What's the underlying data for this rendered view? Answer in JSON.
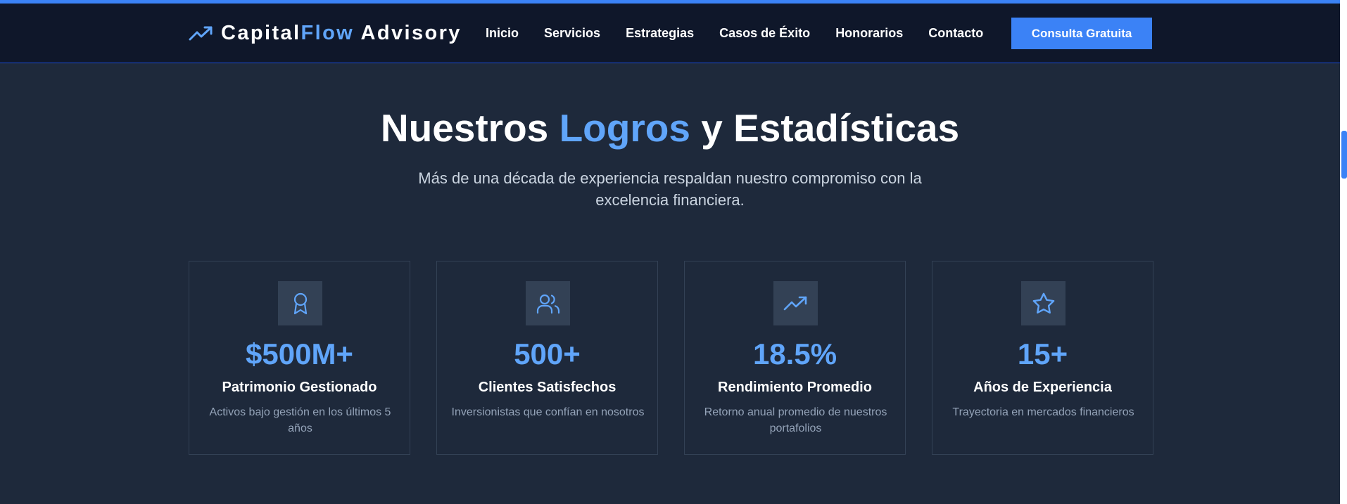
{
  "brand": {
    "name_part1": "Capital",
    "name_part2": "Flow",
    "name_part3": " Advisory",
    "icon": "trending-up-icon"
  },
  "nav": {
    "items": [
      "Inicio",
      "Servicios",
      "Estrategias",
      "Casos de Éxito",
      "Honorarios",
      "Contacto"
    ],
    "cta_label": "Consulta Gratuita"
  },
  "section": {
    "title_part1": "Nuestros ",
    "title_accent": "Logros",
    "title_part2": " y Estadísticas",
    "subtitle": "Más de una década de experiencia respaldan nuestro compromiso con la excelencia financiera."
  },
  "stats": [
    {
      "icon": "award-icon",
      "value": "$500M+",
      "title": "Patrimonio Gestionado",
      "description": "Activos bajo gestión en los últimos 5 años"
    },
    {
      "icon": "users-icon",
      "value": "500+",
      "title": "Clientes Satisfechos",
      "description": "Inversionistas que confían en nosotros"
    },
    {
      "icon": "trending-up-icon",
      "value": "18.5%",
      "title": "Rendimiento Promedio",
      "description": "Retorno anual promedio de nuestros portafolios"
    },
    {
      "icon": "star-icon",
      "value": "15+",
      "title": "Años de Experiencia",
      "description": "Trayectoria en mercados financieros"
    }
  ],
  "colors": {
    "accent": "#3b82f6",
    "accent_light": "#60a5fa",
    "nav_bg": "#0f172a",
    "page_bg": "#1e293b"
  }
}
